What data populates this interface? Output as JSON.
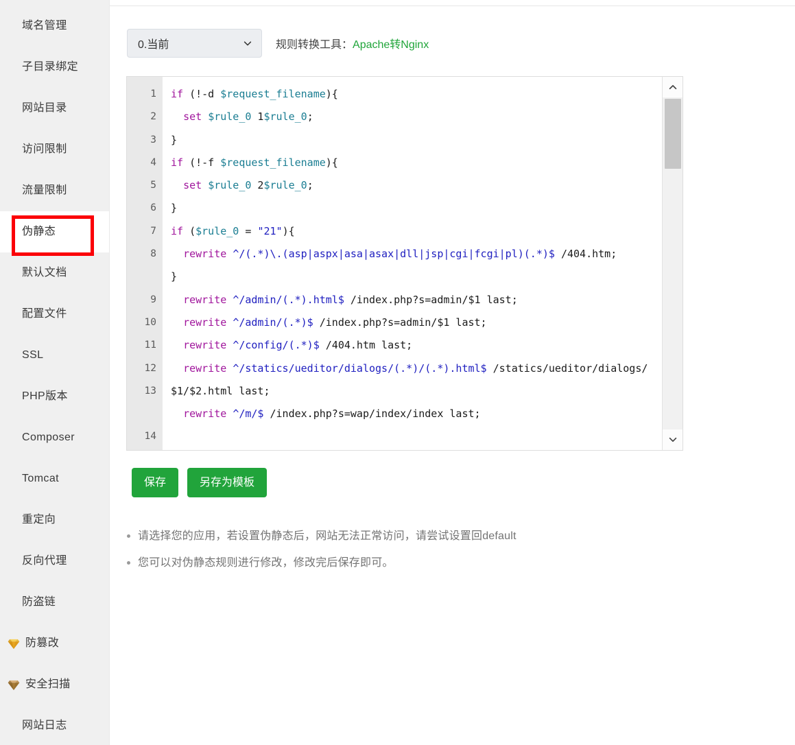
{
  "sidebar": {
    "items": [
      {
        "label": "域名管理",
        "icon": null,
        "active": false
      },
      {
        "label": "子目录绑定",
        "icon": null,
        "active": false
      },
      {
        "label": "网站目录",
        "icon": null,
        "active": false
      },
      {
        "label": "访问限制",
        "icon": null,
        "active": false
      },
      {
        "label": "流量限制",
        "icon": null,
        "active": false
      },
      {
        "label": "伪静态",
        "icon": null,
        "active": true
      },
      {
        "label": "默认文档",
        "icon": null,
        "active": false
      },
      {
        "label": "配置文件",
        "icon": null,
        "active": false
      },
      {
        "label": "SSL",
        "icon": null,
        "active": false
      },
      {
        "label": "PHP版本",
        "icon": null,
        "active": false
      },
      {
        "label": "Composer",
        "icon": null,
        "active": false
      },
      {
        "label": "Tomcat",
        "icon": null,
        "active": false
      },
      {
        "label": "重定向",
        "icon": null,
        "active": false
      },
      {
        "label": "反向代理",
        "icon": null,
        "active": false
      },
      {
        "label": "防盗链",
        "icon": null,
        "active": false
      },
      {
        "label": "防篡改",
        "icon": "gem-icon-gold",
        "active": false
      },
      {
        "label": "安全扫描",
        "icon": "gem-icon-bronze",
        "active": false
      },
      {
        "label": "网站日志",
        "icon": null,
        "active": false
      }
    ]
  },
  "toolbar": {
    "select_value": "0.当前",
    "select_options": [
      "0.当前"
    ],
    "caret_icon": "chevron-down-icon",
    "converter_label": "规则转换工具：",
    "converter_link": "Apache转Nginx"
  },
  "editor": {
    "scrollbar": {
      "up_icon": "chevron-up-icon",
      "down_icon": "chevron-down-icon"
    },
    "line_numbers": [
      "1",
      "2",
      "3",
      "4",
      "5",
      "6",
      "7",
      "8",
      "9",
      "10",
      "11",
      "12",
      "13",
      "14"
    ],
    "lines": [
      {
        "n": "1",
        "wrapped": false,
        "tokens": [
          {
            "t": "if",
            "c": "kw"
          },
          {
            "t": " (!-d ",
            "c": "pl"
          },
          {
            "t": "$request_filename",
            "c": "var"
          },
          {
            "t": "){",
            "c": "pl"
          }
        ]
      },
      {
        "n": "2",
        "wrapped": false,
        "tokens": [
          {
            "t": "  ",
            "c": "pl"
          },
          {
            "t": "set",
            "c": "kw"
          },
          {
            "t": " ",
            "c": "pl"
          },
          {
            "t": "$rule_0",
            "c": "var"
          },
          {
            "t": " 1",
            "c": "pl"
          },
          {
            "t": "$rule_0",
            "c": "var"
          },
          {
            "t": ";",
            "c": "pl"
          }
        ]
      },
      {
        "n": "3",
        "wrapped": false,
        "tokens": [
          {
            "t": "}",
            "c": "pl"
          }
        ]
      },
      {
        "n": "4",
        "wrapped": false,
        "tokens": [
          {
            "t": "if",
            "c": "kw"
          },
          {
            "t": " (!-f ",
            "c": "pl"
          },
          {
            "t": "$request_filename",
            "c": "var"
          },
          {
            "t": "){",
            "c": "pl"
          }
        ]
      },
      {
        "n": "5",
        "wrapped": false,
        "tokens": [
          {
            "t": "  ",
            "c": "pl"
          },
          {
            "t": "set",
            "c": "kw"
          },
          {
            "t": " ",
            "c": "pl"
          },
          {
            "t": "$rule_0",
            "c": "var"
          },
          {
            "t": " 2",
            "c": "pl"
          },
          {
            "t": "$rule_0",
            "c": "var"
          },
          {
            "t": ";",
            "c": "pl"
          }
        ]
      },
      {
        "n": "6",
        "wrapped": false,
        "tokens": [
          {
            "t": "}",
            "c": "pl"
          }
        ]
      },
      {
        "n": "7",
        "wrapped": false,
        "tokens": [
          {
            "t": "if",
            "c": "kw"
          },
          {
            "t": " (",
            "c": "pl"
          },
          {
            "t": "$rule_0",
            "c": "var"
          },
          {
            "t": " = ",
            "c": "pl"
          },
          {
            "t": "\"21\"",
            "c": "str"
          },
          {
            "t": "){",
            "c": "pl"
          }
        ]
      },
      {
        "n": "8",
        "wrapped": true,
        "tokens": [
          {
            "t": "  ",
            "c": "pl"
          },
          {
            "t": "rewrite",
            "c": "kw"
          },
          {
            "t": " ",
            "c": "pl"
          },
          {
            "t": "^/(.*)\\.(asp|aspx|asa|asax|dll|jsp|cgi|fcgi|pl)(.*)$",
            "c": "rx"
          },
          {
            "t": " /404.htm;",
            "c": "pl"
          }
        ]
      },
      {
        "n": "9",
        "wrapped": false,
        "tokens": [
          {
            "t": "}",
            "c": "pl"
          }
        ]
      },
      {
        "n": "10",
        "wrapped": false,
        "tokens": [
          {
            "t": "  ",
            "c": "pl"
          },
          {
            "t": "rewrite",
            "c": "kw"
          },
          {
            "t": " ",
            "c": "pl"
          },
          {
            "t": "^/admin/(.*).html$",
            "c": "rx"
          },
          {
            "t": " /index.php?s=admin/$1 last;",
            "c": "pl"
          }
        ]
      },
      {
        "n": "11",
        "wrapped": false,
        "tokens": [
          {
            "t": "  ",
            "c": "pl"
          },
          {
            "t": "rewrite",
            "c": "kw"
          },
          {
            "t": " ",
            "c": "pl"
          },
          {
            "t": "^/admin/(.*)$",
            "c": "rx"
          },
          {
            "t": " /index.php?s=admin/$1 last;",
            "c": "pl"
          }
        ]
      },
      {
        "n": "12",
        "wrapped": false,
        "tokens": [
          {
            "t": "  ",
            "c": "pl"
          },
          {
            "t": "rewrite",
            "c": "kw"
          },
          {
            "t": " ",
            "c": "pl"
          },
          {
            "t": "^/config/(.*)$",
            "c": "rx"
          },
          {
            "t": " /404.htm last;",
            "c": "pl"
          }
        ]
      },
      {
        "n": "13",
        "wrapped": true,
        "tokens": [
          {
            "t": "  ",
            "c": "pl"
          },
          {
            "t": "rewrite",
            "c": "kw"
          },
          {
            "t": " ",
            "c": "pl"
          },
          {
            "t": "^/statics/ueditor/dialogs/(.*)/(.*).html$",
            "c": "rx"
          },
          {
            "t": " /statics/ueditor/dialogs/$1/$2.html last;",
            "c": "pl"
          }
        ]
      },
      {
        "n": "14",
        "wrapped": false,
        "tokens": [
          {
            "t": "  ",
            "c": "pl"
          },
          {
            "t": "rewrite",
            "c": "kw"
          },
          {
            "t": " ",
            "c": "pl"
          },
          {
            "t": "^/m/$",
            "c": "rx"
          },
          {
            "t": " /index.php?s=wap/index/index last;",
            "c": "pl"
          }
        ]
      }
    ]
  },
  "actions": {
    "save_label": "保存",
    "save_as_template_label": "另存为模板"
  },
  "help": {
    "items": [
      "请选择您的应用，若设置伪静态后，网站无法正常访问，请尝试设置回default",
      "您可以对伪静态规则进行修改，修改完后保存即可。"
    ]
  },
  "colors": {
    "accent_green": "#21a43b",
    "link_green": "#20a53a",
    "annotation_red": "#fb0007",
    "sidebar_bg": "#f0f0f0",
    "gutter_bg": "#e9e9e9",
    "keyword": "#a0159c",
    "variable": "#1a7d92",
    "string": "#2020c0"
  }
}
